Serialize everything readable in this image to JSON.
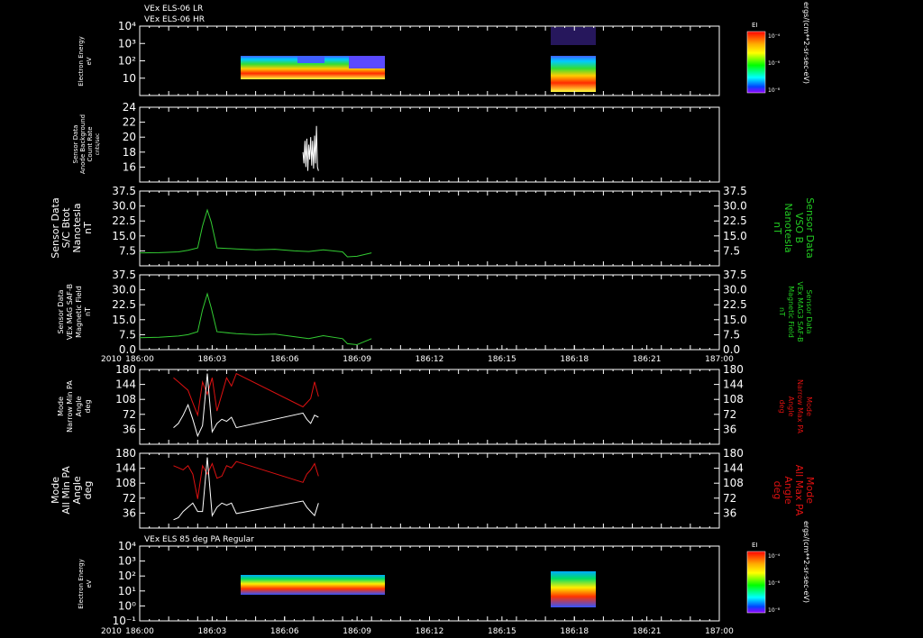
{
  "header": {
    "line1": "VEx ELS-06 LR",
    "line2": "VEx ELS-06 HR"
  },
  "colors": {
    "frame": "#ffffff",
    "mag_trace": "#33cc33",
    "min_pa": "#ffffff",
    "max_pa": "#dd1111",
    "right_label_green": "#22cc22",
    "right_label_red": "#dd1111"
  },
  "x_axis": {
    "range_minutes": [
      0,
      60
    ],
    "year_label": "2010",
    "ticks": [
      "186:00",
      "186:03",
      "186:06",
      "186:09",
      "186:12",
      "186:15",
      "186:18",
      "186:21",
      "187:00"
    ]
  },
  "colorbars": [
    {
      "label": "EI",
      "units": "ergs/(cm**2-sr-sec-eV)",
      "ticks": [
        "10⁻⁴",
        "10⁻⁶",
        "10⁻⁸"
      ]
    },
    {
      "label": "EI",
      "units": "ergs/(cm**2-sr-sec-eV)",
      "ticks": [
        "10⁻⁴",
        "10⁻⁶",
        "10⁻⁸"
      ]
    }
  ],
  "chart_data": [
    {
      "type": "heatmap",
      "panel": "els-lr-hr",
      "ylabel": [
        "Electron Energy",
        "eV"
      ],
      "yscale": "log",
      "ylim": [
        1,
        10000
      ],
      "yticks": [
        "10⁴",
        "10³",
        "10²",
        "10"
      ],
      "coverage_minutes": [
        [
          3.5,
          10.1
        ],
        [
          16.9,
          18.5
        ]
      ]
    },
    {
      "type": "line",
      "panel": "anode-background",
      "ylabel": [
        "Sensor Data",
        "Anode Background",
        "Count Rate",
        "cnts/sec"
      ],
      "ylim": [
        14,
        24
      ],
      "yticks": [
        16,
        18,
        20,
        22,
        24
      ],
      "series": [
        {
          "x": [
            16.9,
            17.0,
            17.1,
            17.2,
            17.3,
            17.4,
            17.5,
            17.6,
            17.7,
            17.8,
            17.9,
            18.0,
            18.1,
            18.2,
            18.3,
            18.4,
            18.5
          ],
          "values": [
            18.0,
            16.5,
            19.5,
            16.0,
            19.8,
            15.5,
            19.0,
            17.0,
            20.0,
            16.2,
            19.5,
            15.8,
            20.2,
            16.5,
            21.5,
            16.0,
            15.5
          ]
        }
      ]
    },
    {
      "type": "line",
      "panel": "sc-btot",
      "ylabel": [
        "Sensor Data",
        "S/C Btot",
        "Nanotesla",
        "nT"
      ],
      "right_label": [
        "Sensor Data",
        "VSO B",
        "Nanotesla",
        "nT"
      ],
      "ylim": [
        0,
        37.5
      ],
      "yticks": [
        "7.5",
        "15.0",
        "22.5",
        "30.0",
        "37.5"
      ],
      "series": [
        {
          "x": [
            0,
            2,
            4,
            5,
            6,
            6.5,
            7.0,
            7.4,
            8,
            10,
            12,
            14,
            16,
            17.5,
            19,
            21,
            21.5,
            22.5,
            24
          ],
          "values": [
            6.5,
            6.6,
            7.0,
            7.8,
            9,
            20,
            28,
            22,
            9,
            8.5,
            8,
            8.3,
            7.5,
            7.2,
            8.0,
            7.0,
            4.5,
            4.8,
            6.5
          ]
        }
      ]
    },
    {
      "type": "line",
      "panel": "mag-saf-b",
      "ylabel": [
        "Sensor Data",
        "VEx MAG SAF-B",
        "Magnetic Field",
        "nT"
      ],
      "right_label": [
        "Sensor Data",
        "VEx MAG3 SAF-B",
        "Magnetic Field",
        "nT"
      ],
      "ylim": [
        0,
        37.5
      ],
      "yticks": [
        "0.0",
        "7.5",
        "15.0",
        "22.5",
        "30.0",
        "37.5"
      ],
      "series": [
        {
          "x": [
            0,
            2,
            4,
            5,
            6,
            6.5,
            7.0,
            7.4,
            8,
            10,
            12,
            14,
            16,
            17.5,
            19,
            21,
            21.5,
            22.5,
            24
          ],
          "values": [
            6.0,
            6.2,
            6.8,
            7.5,
            9,
            20,
            28,
            21,
            9,
            8.0,
            7.5,
            7.8,
            6.5,
            5.5,
            7.0,
            5.5,
            3.0,
            2.5,
            5.5
          ]
        }
      ]
    },
    {
      "type": "line",
      "panel": "narrow-pa",
      "ylabel": [
        "Mode",
        "Narrow Min PA",
        "Angle",
        "deg"
      ],
      "right_label": [
        "Mode",
        "Narrow Max PA",
        "Angle",
        "deg"
      ],
      "ylim": [
        0,
        180
      ],
      "yticks": [
        36,
        72,
        108,
        144,
        180
      ],
      "series": [
        {
          "name": "min",
          "x": [
            3.5,
            4.0,
            4.5,
            5.0,
            5.5,
            6.0,
            6.5,
            7.0,
            7.5,
            8.0,
            8.5,
            9.0,
            9.5,
            10.0,
            16.9,
            17.3,
            17.7,
            18.1,
            18.5
          ],
          "values": [
            40,
            50,
            70,
            95,
            60,
            20,
            45,
            170,
            30,
            50,
            60,
            55,
            65,
            40,
            75,
            60,
            50,
            70,
            65
          ]
        },
        {
          "name": "max",
          "x": [
            3.5,
            4.0,
            4.5,
            5.0,
            5.5,
            6.0,
            6.5,
            7.0,
            7.5,
            8.0,
            8.5,
            9.0,
            9.5,
            10.0,
            16.9,
            17.3,
            17.7,
            18.1,
            18.5
          ],
          "values": [
            160,
            150,
            140,
            130,
            100,
            70,
            150,
            120,
            160,
            80,
            120,
            160,
            140,
            170,
            90,
            100,
            110,
            150,
            115
          ]
        }
      ]
    },
    {
      "type": "line",
      "panel": "all-pa",
      "ylabel": [
        "Mode",
        "All Min PA",
        "Angle",
        "deg"
      ],
      "right_label": [
        "Mode",
        "All Max PA",
        "Angle",
        "deg"
      ],
      "ylim": [
        0,
        180
      ],
      "yticks": [
        36,
        72,
        108,
        144,
        180
      ],
      "series": [
        {
          "name": "min",
          "x": [
            3.5,
            4.0,
            4.5,
            5.0,
            5.5,
            6.0,
            6.5,
            7.0,
            7.5,
            8.0,
            8.5,
            9.0,
            9.5,
            10.0,
            16.9,
            17.3,
            17.7,
            18.1,
            18.5
          ],
          "values": [
            20,
            25,
            40,
            50,
            60,
            40,
            40,
            170,
            30,
            50,
            60,
            55,
            60,
            35,
            65,
            50,
            40,
            30,
            60
          ]
        },
        {
          "name": "max",
          "x": [
            3.5,
            4.0,
            4.5,
            5.0,
            5.5,
            6.0,
            6.5,
            7.0,
            7.5,
            8.0,
            8.5,
            9.0,
            9.5,
            10.0,
            16.9,
            17.3,
            17.7,
            18.1,
            18.5
          ],
          "values": [
            150,
            145,
            140,
            150,
            130,
            70,
            150,
            130,
            155,
            120,
            125,
            150,
            145,
            160,
            110,
            130,
            140,
            155,
            125
          ]
        }
      ]
    },
    {
      "type": "heatmap",
      "panel": "els-85-pa",
      "title": "VEx ELS 85 deg PA Regular",
      "ylabel": [
        "Electron Energy",
        "eV"
      ],
      "yscale": "log",
      "ylim": [
        0.1,
        10000
      ],
      "yticks": [
        "10⁴",
        "10³",
        "10²",
        "10¹",
        "10⁰",
        "10⁻¹"
      ],
      "coverage_minutes": [
        [
          3.5,
          10.1
        ],
        [
          16.9,
          18.5
        ]
      ]
    }
  ]
}
